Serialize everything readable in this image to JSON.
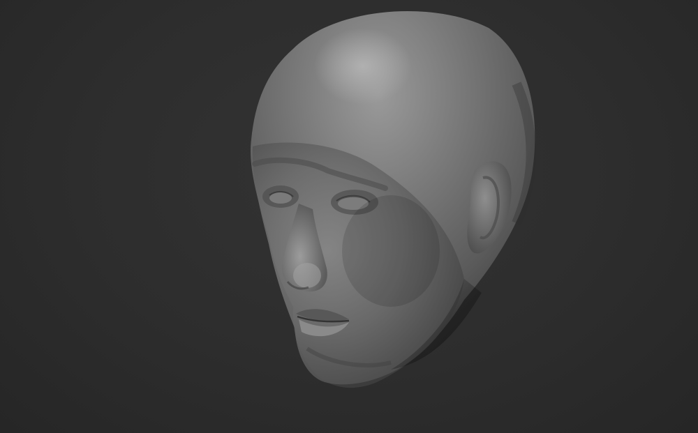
{
  "viewport": {
    "background_color": "#2e2e2e",
    "model": {
      "subject": "sculpted-head-bust",
      "material_color": "#6e6e6e",
      "highlight_color": "#a0a0a0",
      "shadow_color": "#3a3a3a"
    }
  }
}
